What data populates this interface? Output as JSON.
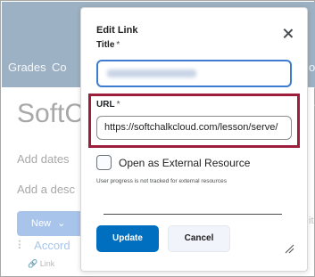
{
  "background": {
    "nav_items": [
      "Grades",
      "Co"
    ],
    "heading": "SoftC",
    "add_dates": "Add dates",
    "add_desc": "Add a desc",
    "new_button": "New",
    "accordion_title": "Accord",
    "link_label": "Link",
    "right_char_top": "o",
    "right_char_mid": "it"
  },
  "dialog": {
    "title": "Edit Link",
    "close_icon": "close-icon",
    "title_label": "Title",
    "required_marker": "*",
    "url_label": "URL",
    "url_value": "https://softchalkcloud.com/lesson/serve/",
    "external_label": "Open as External Resource",
    "external_checked": false,
    "external_help": "User progress is not tracked for external resources",
    "update_label": "Update",
    "cancel_label": "Cancel"
  },
  "colors": {
    "primary": "#006fbf",
    "highlight": "#9d1d3c",
    "focus": "#3d7cd1"
  }
}
